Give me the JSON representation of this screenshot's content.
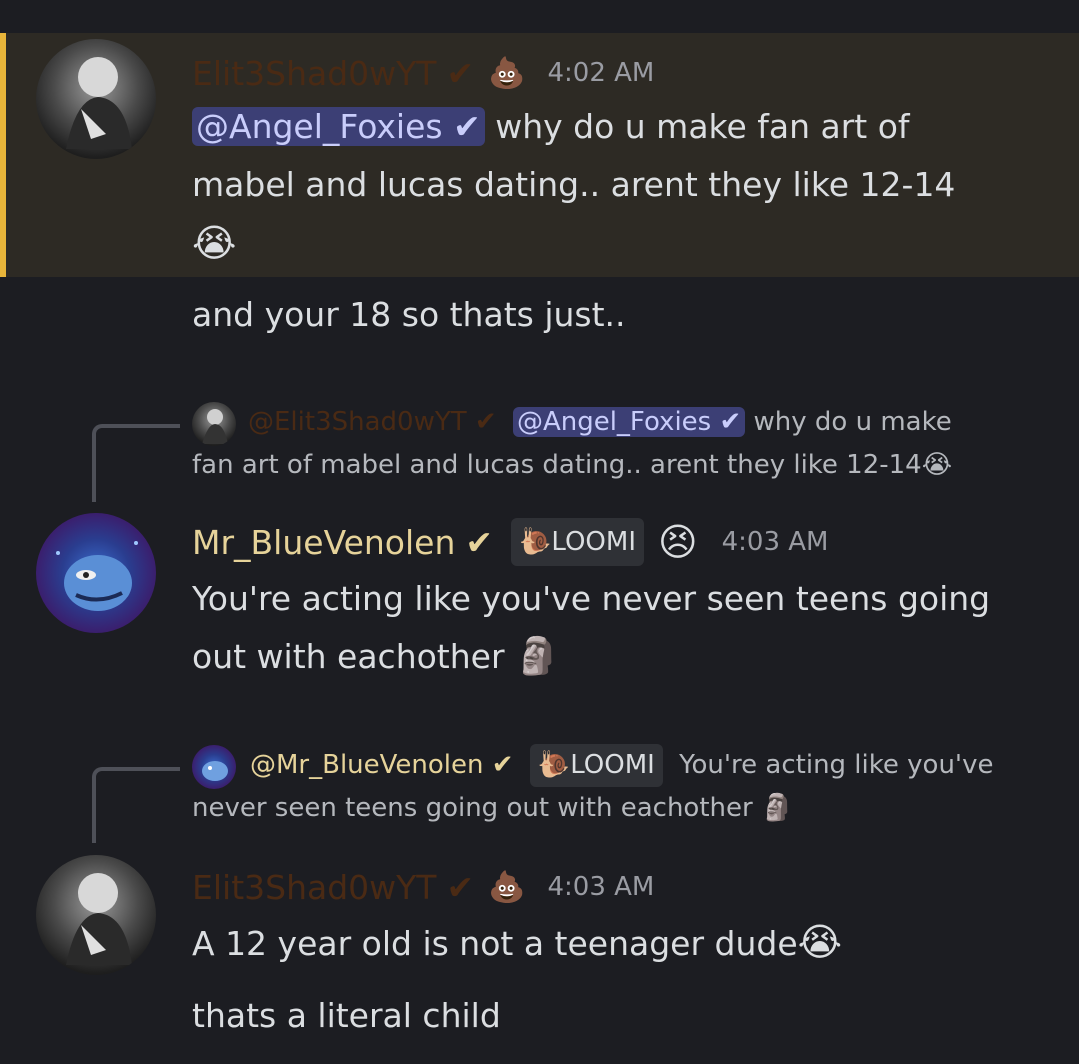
{
  "messages": [
    {
      "author": "Elit3Shad0wYT",
      "verified": "✔",
      "emoji": "💩",
      "time": "4:02 AM",
      "mention": "@Angel_Foxies ✔",
      "line1": " why do u make fan art of",
      "line2": "mabel and lucas dating.. arent they like 12-14",
      "line3_emoji": "😭",
      "followup": "and your 18 so thats just.."
    },
    {
      "reply": {
        "author": "@Elit3Shad0wYT",
        "verified": "✔",
        "mention": "@Angel_Foxies ✔",
        "text1": " why do u make",
        "text2": "fan art of mabel and lucas dating.. arent they like 12-14",
        "emoji": "😭"
      },
      "author": "Mr_BlueVenolen",
      "verified": "✔",
      "tag": "LOOMI",
      "emoji": "😣",
      "time": "4:03 AM",
      "line1": "You're acting like you've never seen teens going",
      "line2": "out with eachother",
      "line2_emoji": "🗿"
    },
    {
      "reply": {
        "author": "@Mr_BlueVenolen",
        "verified": "✔",
        "tag": "LOOMI",
        "text1": "You're acting like you've",
        "text2": "never seen teens going out with eachother",
        "emoji": "🗿"
      },
      "author": "Elit3Shad0wYT",
      "verified": "✔",
      "emoji": "💩",
      "time": "4:03 AM",
      "line1": "A 12 year old is not a teenager dude",
      "line1_emoji": "😭",
      "line2": "thats a literal child"
    }
  ],
  "colors": {
    "background": "#1c1d22",
    "highlight": "#2d2a24",
    "highlight_bar": "#e8b53a",
    "mention_bg": "#3c3f75",
    "elite_name": "#4a2a14",
    "blue_name": "#e6d39a"
  }
}
